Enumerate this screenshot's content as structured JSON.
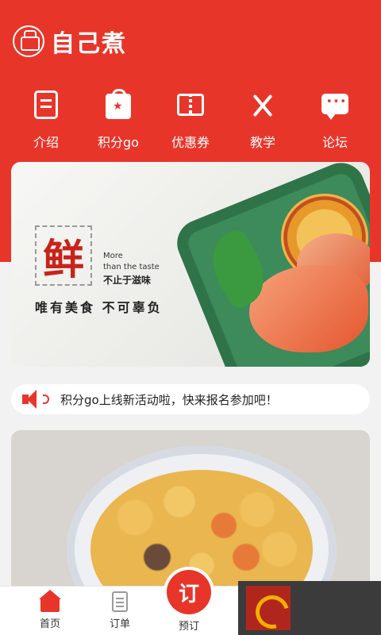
{
  "app": {
    "name": "自己煮"
  },
  "nav": {
    "items": [
      {
        "label": "介绍",
        "icon": "document-icon"
      },
      {
        "label": "积分go",
        "icon": "shopping-bag-star-icon"
      },
      {
        "label": "优惠券",
        "icon": "ticket-icon"
      },
      {
        "label": "教学",
        "icon": "fork-knife-icon"
      },
      {
        "label": "论坛",
        "icon": "chat-bubble-icon"
      }
    ]
  },
  "banner": {
    "seal_char": "鲜",
    "english_line1": "More",
    "english_line2": "than the taste",
    "tagline": "不止于滋味",
    "slogan": "唯有美食  不可辜负"
  },
  "notice": {
    "text": "积分go上线新活动啦，快来报名参加吧！",
    "icon": "speaker-icon"
  },
  "tabbar": {
    "home_label": "首页",
    "order_label": "订单",
    "reserve_label": "预订",
    "reserve_button_text": "订"
  },
  "colors": {
    "brand_red": "#e8352a",
    "background": "#f2f2f2"
  }
}
